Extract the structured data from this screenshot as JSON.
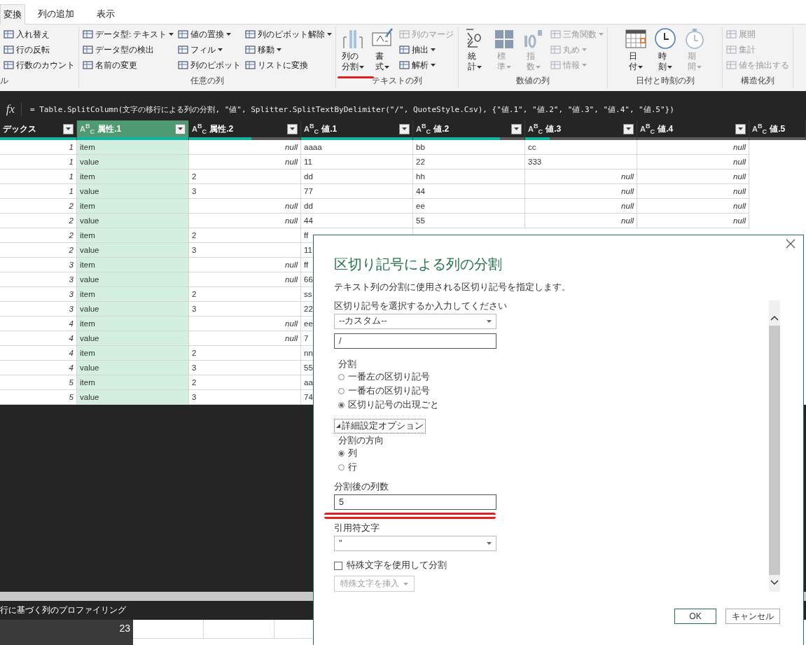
{
  "ribbon_tabs": [
    {
      "label": "変換",
      "selected": true
    },
    {
      "label": "列の追加",
      "selected": false
    },
    {
      "label": "表示",
      "selected": false
    }
  ],
  "ribbon_groups": [
    {
      "label": "ル",
      "small": [
        [
          {
            "label": "入れ替え",
            "dropdown": false,
            "disabled": false
          },
          {
            "label": "行の反転",
            "dropdown": false,
            "disabled": false
          },
          {
            "label": "行数のカウント",
            "dropdown": false,
            "disabled": false
          }
        ]
      ]
    },
    {
      "label": "任意の列",
      "small": [
        [
          {
            "label": "データ型: テキスト",
            "dropdown": true,
            "disabled": false
          },
          {
            "label": "データ型の検出",
            "dropdown": false,
            "disabled": false
          },
          {
            "label": "名前の変更",
            "dropdown": false,
            "disabled": false
          }
        ],
        [
          {
            "label": "値の置換",
            "dropdown": true,
            "disabled": false
          },
          {
            "label": "フィル",
            "dropdown": true,
            "disabled": false
          },
          {
            "label": "列のピボット",
            "dropdown": false,
            "disabled": false
          }
        ],
        [
          {
            "label": "列のピボット解除",
            "dropdown": true,
            "disabled": false
          },
          {
            "label": "移動",
            "dropdown": true,
            "disabled": false
          },
          {
            "label": "リストに変換",
            "dropdown": false,
            "disabled": false
          }
        ]
      ]
    },
    {
      "label": "テキストの列",
      "large": [
        {
          "label": "列の分割",
          "dropdown": true,
          "disabled": false,
          "marked": true
        },
        {
          "label": "書式",
          "dropdown": true,
          "disabled": false,
          "marked": false
        }
      ],
      "small": [
        [
          {
            "label": "列のマージ",
            "dropdown": false,
            "disabled": true
          },
          {
            "label": "抽出",
            "dropdown": true,
            "disabled": false
          },
          {
            "label": "解析",
            "dropdown": true,
            "disabled": false
          }
        ]
      ]
    },
    {
      "label": "数値の列",
      "large": [
        {
          "label": "統計",
          "dropdown": true,
          "disabled": false,
          "marked": false
        },
        {
          "label": "標準",
          "dropdown": true,
          "disabled": true,
          "marked": false
        },
        {
          "label": "指数",
          "dropdown": true,
          "disabled": true,
          "marked": false
        }
      ],
      "small": [
        [
          {
            "label": "三角関数",
            "dropdown": true,
            "disabled": true
          },
          {
            "label": "丸め",
            "dropdown": true,
            "disabled": true
          },
          {
            "label": "情報",
            "dropdown": true,
            "disabled": true
          }
        ]
      ]
    },
    {
      "label": "日付と時刻の列",
      "large": [
        {
          "label": "日付",
          "dropdown": true,
          "disabled": false,
          "marked": false
        },
        {
          "label": "時刻",
          "dropdown": true,
          "disabled": false,
          "marked": false
        },
        {
          "label": "期間",
          "dropdown": true,
          "disabled": true,
          "marked": false
        }
      ]
    },
    {
      "label": "構造化列",
      "small": [
        [
          {
            "label": "展開",
            "dropdown": false,
            "disabled": true
          },
          {
            "label": "集計",
            "dropdown": false,
            "disabled": true
          },
          {
            "label": "値を抽出する",
            "dropdown": false,
            "disabled": true
          }
        ]
      ]
    }
  ],
  "formula_bar": {
    "fx": "fx",
    "formula": "= Table.SplitColumn(文字の移行による列の分割, \"値\", Splitter.SplitTextByDelimiter(\"/\", QuoteStyle.Csv), {\"値.1\", \"値.2\", \"値.3\", \"値.4\", \"値.5\"})"
  },
  "table": {
    "columns": [
      {
        "name": "デックス",
        "selected": false,
        "level": 1
      },
      {
        "name": "属性.1",
        "type_label": "A$^{B}$$_{C}$",
        "selected": true,
        "level": 1
      },
      {
        "name": "属性.2",
        "type_label": "A$^{B}$$_{C}$",
        "selected": false,
        "level": 0.56
      },
      {
        "name": "値.1",
        "type_label": "A$^{B}$$_{C}$",
        "selected": false,
        "level": 1
      },
      {
        "name": "値.2",
        "type_label": "A$^{B}$$_{C}$",
        "selected": false,
        "level": 0.78
      },
      {
        "name": "値.3",
        "type_label": "A$^{B}$$_{C}$",
        "selected": false,
        "level": 0.22
      },
      {
        "name": "値.4",
        "type_label": "A$^{B}$$_{C}$",
        "selected": false,
        "level": 0
      },
      {
        "name": "値.5",
        "type_label": "A$^{B}$$_{C}$",
        "selected": false,
        "level": 0
      }
    ],
    "rows": [
      {
        "cells": [
          {
            "text": "1",
            "kind": "number"
          },
          {
            "text": "item",
            "kind": "text"
          },
          {
            "text": "null",
            "kind": "null"
          },
          {
            "text": "aaaa",
            "kind": "text"
          },
          {
            "text": "bb",
            "kind": "text"
          },
          {
            "text": "cc",
            "kind": "text"
          },
          {
            "text": "null",
            "kind": "null"
          }
        ]
      },
      {
        "cells": [
          {
            "text": "1",
            "kind": "number"
          },
          {
            "text": "value",
            "kind": "text"
          },
          {
            "text": "null",
            "kind": "null"
          },
          {
            "text": "11",
            "kind": "text"
          },
          {
            "text": "22",
            "kind": "text"
          },
          {
            "text": "333",
            "kind": "text"
          },
          {
            "text": "null",
            "kind": "null"
          }
        ]
      },
      {
        "cells": [
          {
            "text": "1",
            "kind": "number"
          },
          {
            "text": "item",
            "kind": "text"
          },
          {
            "text": "2",
            "kind": "text"
          },
          {
            "text": "dd",
            "kind": "text"
          },
          {
            "text": "hh",
            "kind": "text"
          },
          {
            "text": "null",
            "kind": "null"
          },
          {
            "text": "null",
            "kind": "null"
          }
        ]
      },
      {
        "cells": [
          {
            "text": "1",
            "kind": "number"
          },
          {
            "text": "value",
            "kind": "text"
          },
          {
            "text": "3",
            "kind": "text"
          },
          {
            "text": "77",
            "kind": "text"
          },
          {
            "text": "44",
            "kind": "text"
          },
          {
            "text": "null",
            "kind": "null"
          },
          {
            "text": "null",
            "kind": "null"
          }
        ]
      },
      {
        "cells": [
          {
            "text": "2",
            "kind": "number"
          },
          {
            "text": "item",
            "kind": "text"
          },
          {
            "text": "null",
            "kind": "null"
          },
          {
            "text": "dd",
            "kind": "text"
          },
          {
            "text": "ee",
            "kind": "text"
          },
          {
            "text": "null",
            "kind": "null"
          },
          {
            "text": "null",
            "kind": "null"
          }
        ]
      },
      {
        "cells": [
          {
            "text": "2",
            "kind": "number"
          },
          {
            "text": "value",
            "kind": "text"
          },
          {
            "text": "null",
            "kind": "null"
          },
          {
            "text": "44",
            "kind": "text"
          },
          {
            "text": "55",
            "kind": "text"
          },
          {
            "text": "null",
            "kind": "null"
          },
          {
            "text": "null",
            "kind": "null"
          }
        ]
      },
      {
        "cells": [
          {
            "text": "2",
            "kind": "number"
          },
          {
            "text": "item",
            "kind": "text"
          },
          {
            "text": "2",
            "kind": "text"
          },
          {
            "text": "ff",
            "kind": "text"
          }
        ]
      },
      {
        "cells": [
          {
            "text": "2",
            "kind": "number"
          },
          {
            "text": "value",
            "kind": "text"
          },
          {
            "text": "3",
            "kind": "text"
          },
          {
            "text": "11",
            "kind": "text"
          }
        ]
      },
      {
        "cells": [
          {
            "text": "3",
            "kind": "number"
          },
          {
            "text": "item",
            "kind": "text"
          },
          {
            "text": "null",
            "kind": "null"
          },
          {
            "text": "ff",
            "kind": "text"
          }
        ]
      },
      {
        "cells": [
          {
            "text": "3",
            "kind": "number"
          },
          {
            "text": "value",
            "kind": "text"
          },
          {
            "text": "null",
            "kind": "null"
          },
          {
            "text": "66",
            "kind": "text"
          }
        ]
      },
      {
        "cells": [
          {
            "text": "3",
            "kind": "number"
          },
          {
            "text": "item",
            "kind": "text"
          },
          {
            "text": "2",
            "kind": "text"
          },
          {
            "text": "ss",
            "kind": "text"
          }
        ]
      },
      {
        "cells": [
          {
            "text": "3",
            "kind": "number"
          },
          {
            "text": "value",
            "kind": "text"
          },
          {
            "text": "3",
            "kind": "text"
          },
          {
            "text": "22",
            "kind": "text"
          }
        ]
      },
      {
        "cells": [
          {
            "text": "4",
            "kind": "number"
          },
          {
            "text": "item",
            "kind": "text"
          },
          {
            "text": "null",
            "kind": "null"
          },
          {
            "text": "ee",
            "kind": "text"
          }
        ]
      },
      {
        "cells": [
          {
            "text": "4",
            "kind": "number"
          },
          {
            "text": "value",
            "kind": "text"
          },
          {
            "text": "null",
            "kind": "null"
          },
          {
            "text": "7",
            "kind": "text"
          }
        ]
      },
      {
        "cells": [
          {
            "text": "4",
            "kind": "number"
          },
          {
            "text": "item",
            "kind": "text"
          },
          {
            "text": "2",
            "kind": "text"
          },
          {
            "text": "nn",
            "kind": "text"
          }
        ]
      },
      {
        "cells": [
          {
            "text": "4",
            "kind": "number"
          },
          {
            "text": "value",
            "kind": "text"
          },
          {
            "text": "3",
            "kind": "text"
          },
          {
            "text": "55",
            "kind": "text"
          }
        ]
      },
      {
        "cells": [
          {
            "text": "5",
            "kind": "number"
          },
          {
            "text": "item",
            "kind": "text"
          },
          {
            "text": "2",
            "kind": "text"
          },
          {
            "text": "aa",
            "kind": "text"
          }
        ]
      },
      {
        "cells": [
          {
            "text": "5",
            "kind": "number"
          },
          {
            "text": "value",
            "kind": "text"
          },
          {
            "text": "3",
            "kind": "text"
          },
          {
            "text": "74",
            "kind": "text"
          }
        ]
      }
    ]
  },
  "status_bar": {
    "text": "行に基づく列のプロファイリング"
  },
  "sheet": {
    "row_header": "23"
  },
  "dialog": {
    "title": "区切り記号による列の分割",
    "description": "テキスト列の分割に使用される区切り記号を指定します。",
    "delimiter_label": "区切り記号を選択するか入力してください",
    "delimiter_select": "--カスタム--",
    "delimiter_value": "/",
    "split_label": "分割",
    "split_options": [
      {
        "label": "一番左の区切り記号",
        "selected": false
      },
      {
        "label": "一番右の区切り記号",
        "selected": false
      },
      {
        "label": "区切り記号の出現ごと",
        "selected": true
      }
    ],
    "advanced": {
      "label": "詳細設定オプション",
      "expanded": true
    },
    "direction_label": "分割の方向",
    "direction_options": [
      {
        "label": "列",
        "selected": true
      },
      {
        "label": "行",
        "selected": false
      }
    ],
    "column_count_label": "分割後の列数",
    "column_count_value": "5",
    "column_count_marked": true,
    "quote_label": "引用符文字",
    "quote_select": "\"",
    "special_checkbox": {
      "label": "特殊文字を使用して分割",
      "checked": false
    },
    "insert_special": {
      "label": "特殊文字を挿入",
      "disabled": true
    },
    "buttons": [
      {
        "label": "OK",
        "kind": "primary"
      },
      {
        "label": "キャンセル",
        "kind": "secondary"
      }
    ]
  }
}
